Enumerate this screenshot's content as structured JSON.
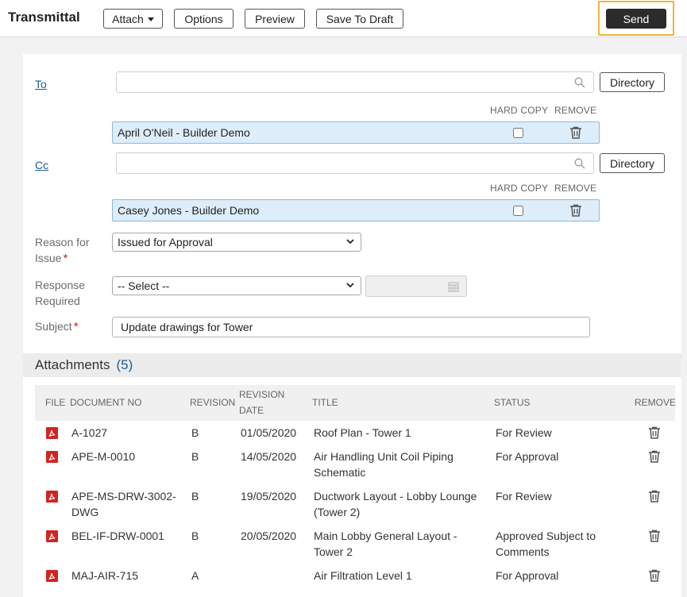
{
  "header": {
    "title": "Transmittal",
    "attach_label": "Attach",
    "options_label": "Options",
    "preview_label": "Preview",
    "save_draft_label": "Save To Draft",
    "send_label": "Send"
  },
  "form": {
    "to": {
      "label": "To",
      "search_value": "",
      "directory_label": "Directory",
      "hard_copy_header": "HARD COPY",
      "remove_header": "REMOVE",
      "recipients": [
        {
          "name": "April O'Neil - Builder Demo",
          "hard_copy": false
        }
      ]
    },
    "cc": {
      "label": "Cc",
      "search_value": "",
      "directory_label": "Directory",
      "hard_copy_header": "HARD COPY",
      "remove_header": "REMOVE",
      "recipients": [
        {
          "name": "Casey Jones - Builder Demo",
          "hard_copy": false
        }
      ]
    },
    "reason": {
      "label_line1": "Reason for",
      "label_line2": "Issue",
      "required_mark": "*",
      "selected": "Issued for Approval"
    },
    "response": {
      "label_line1": "Response",
      "label_line2": "Required",
      "selected": "-- Select --",
      "date_value": ""
    },
    "subject": {
      "label": "Subject",
      "required_mark": "*",
      "value": "Update drawings for Tower"
    }
  },
  "attachments": {
    "title": "Attachments",
    "count": "(5)",
    "columns": {
      "file": "FILE",
      "document_no": "DOCUMENT NO",
      "revision": "REVISION",
      "revision_date_line1": "REVISION",
      "revision_date_line2": "DATE",
      "title": "TITLE",
      "status": "STATUS",
      "remove": "REMOVE"
    },
    "rows": [
      {
        "doc_line1": "A-1027",
        "doc_line2": "",
        "revision": "B",
        "date": "01/05/2020",
        "title_line1": "Roof Plan - Tower 1",
        "title_line2": "",
        "status_line1": "For Review",
        "status_line2": ""
      },
      {
        "doc_line1": "APE-M-0010",
        "doc_line2": "",
        "revision": "B",
        "date": "14/05/2020",
        "title_line1": "Air Handling Unit Coil Piping",
        "title_line2": "Schematic",
        "status_line1": "For Approval",
        "status_line2": ""
      },
      {
        "doc_line1": "APE-MS-DRW-3002-",
        "doc_line2": "DWG",
        "revision": "B",
        "date": "19/05/2020",
        "title_line1": "Ductwork Layout - Lobby Lounge",
        "title_line2": "(Tower 2)",
        "status_line1": "For Review",
        "status_line2": ""
      },
      {
        "doc_line1": "BEL-IF-DRW-0001",
        "doc_line2": "",
        "revision": "B",
        "date": "20/05/2020",
        "title_line1": "Main Lobby General Layout -",
        "title_line2": "Tower 2",
        "status_line1": "Approved Subject to",
        "status_line2": "Comments"
      },
      {
        "doc_line1": "MAJ-AIR-715",
        "doc_line2": "",
        "revision": "A",
        "date": "",
        "title_line1": "Air Filtration Level 1",
        "title_line2": "",
        "status_line1": "For Approval",
        "status_line2": ""
      }
    ]
  },
  "icons": {
    "search": "search-icon",
    "trash": "trash-icon",
    "calendar": "calendar-icon",
    "pdf": "pdf-file-icon",
    "chevron": "chevron-down-icon"
  },
  "colors": {
    "send_bg": "#2b2b2b",
    "send_highlight": "#f0b534",
    "link": "#1a5e9c",
    "recipient_bg": "#deedfa",
    "recipient_border": "#8bb9e0",
    "pdf_red": "#d32323",
    "required": "#cc2222"
  }
}
